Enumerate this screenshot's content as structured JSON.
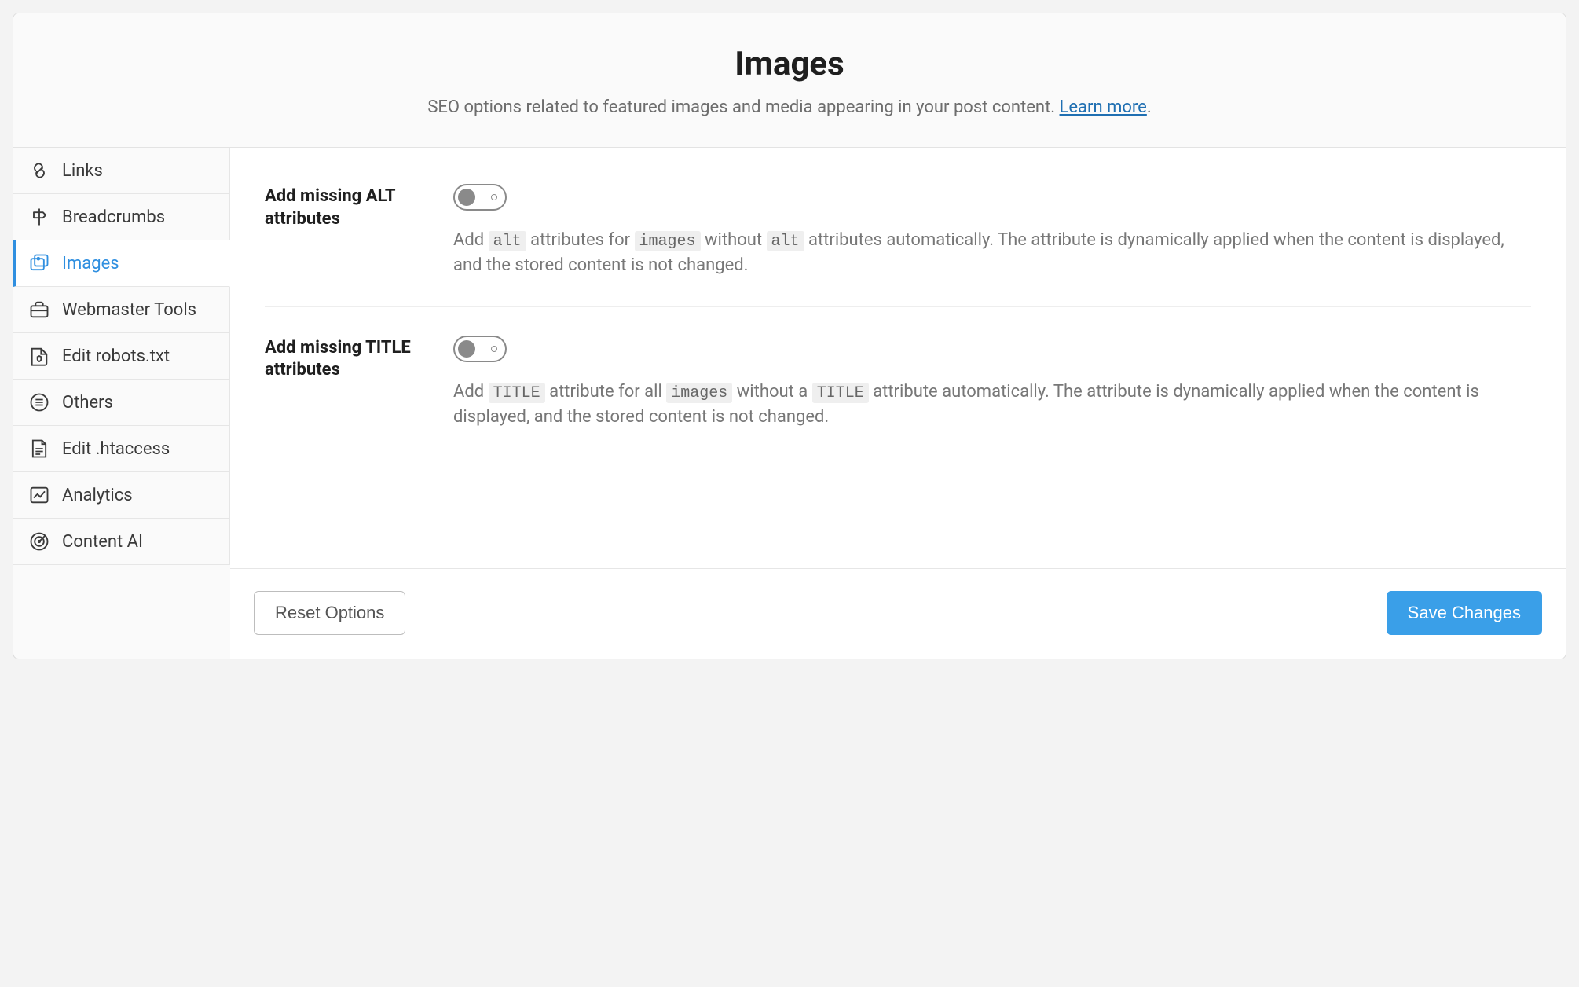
{
  "header": {
    "title": "Images",
    "subtitle_before": "SEO options related to featured images and media appearing in your post content. ",
    "learn_more": "Learn more",
    "subtitle_after": "."
  },
  "sidebar": {
    "items": [
      {
        "key": "links",
        "label": "Links",
        "active": false
      },
      {
        "key": "breadcrumbs",
        "label": "Breadcrumbs",
        "active": false
      },
      {
        "key": "images",
        "label": "Images",
        "active": true
      },
      {
        "key": "webmaster-tools",
        "label": "Webmaster Tools",
        "active": false
      },
      {
        "key": "edit-robots",
        "label": "Edit robots.txt",
        "active": false
      },
      {
        "key": "others",
        "label": "Others",
        "active": false
      },
      {
        "key": "edit-htaccess",
        "label": "Edit .htaccess",
        "active": false
      },
      {
        "key": "analytics",
        "label": "Analytics",
        "active": false
      },
      {
        "key": "content-ai",
        "label": "Content AI",
        "active": false
      }
    ]
  },
  "settings": {
    "alt": {
      "label": "Add missing ALT attributes",
      "state": "off",
      "desc_parts": [
        "Add ",
        {
          "code": "alt"
        },
        " attributes for ",
        {
          "code": "images"
        },
        " without ",
        {
          "code": "alt"
        },
        " attributes automatically. The attribute is dynamically applied when the content is displayed, and the stored content is not changed."
      ]
    },
    "title": {
      "label": "Add missing TITLE attributes",
      "state": "off",
      "desc_parts": [
        "Add ",
        {
          "code": "TITLE"
        },
        " attribute for all ",
        {
          "code": "images"
        },
        " without a ",
        {
          "code": "TITLE"
        },
        " attribute automatically. The attribute is dynamically applied when the content is displayed, and the stored content is not changed."
      ]
    }
  },
  "footer": {
    "reset": "Reset Options",
    "save": "Save Changes"
  }
}
